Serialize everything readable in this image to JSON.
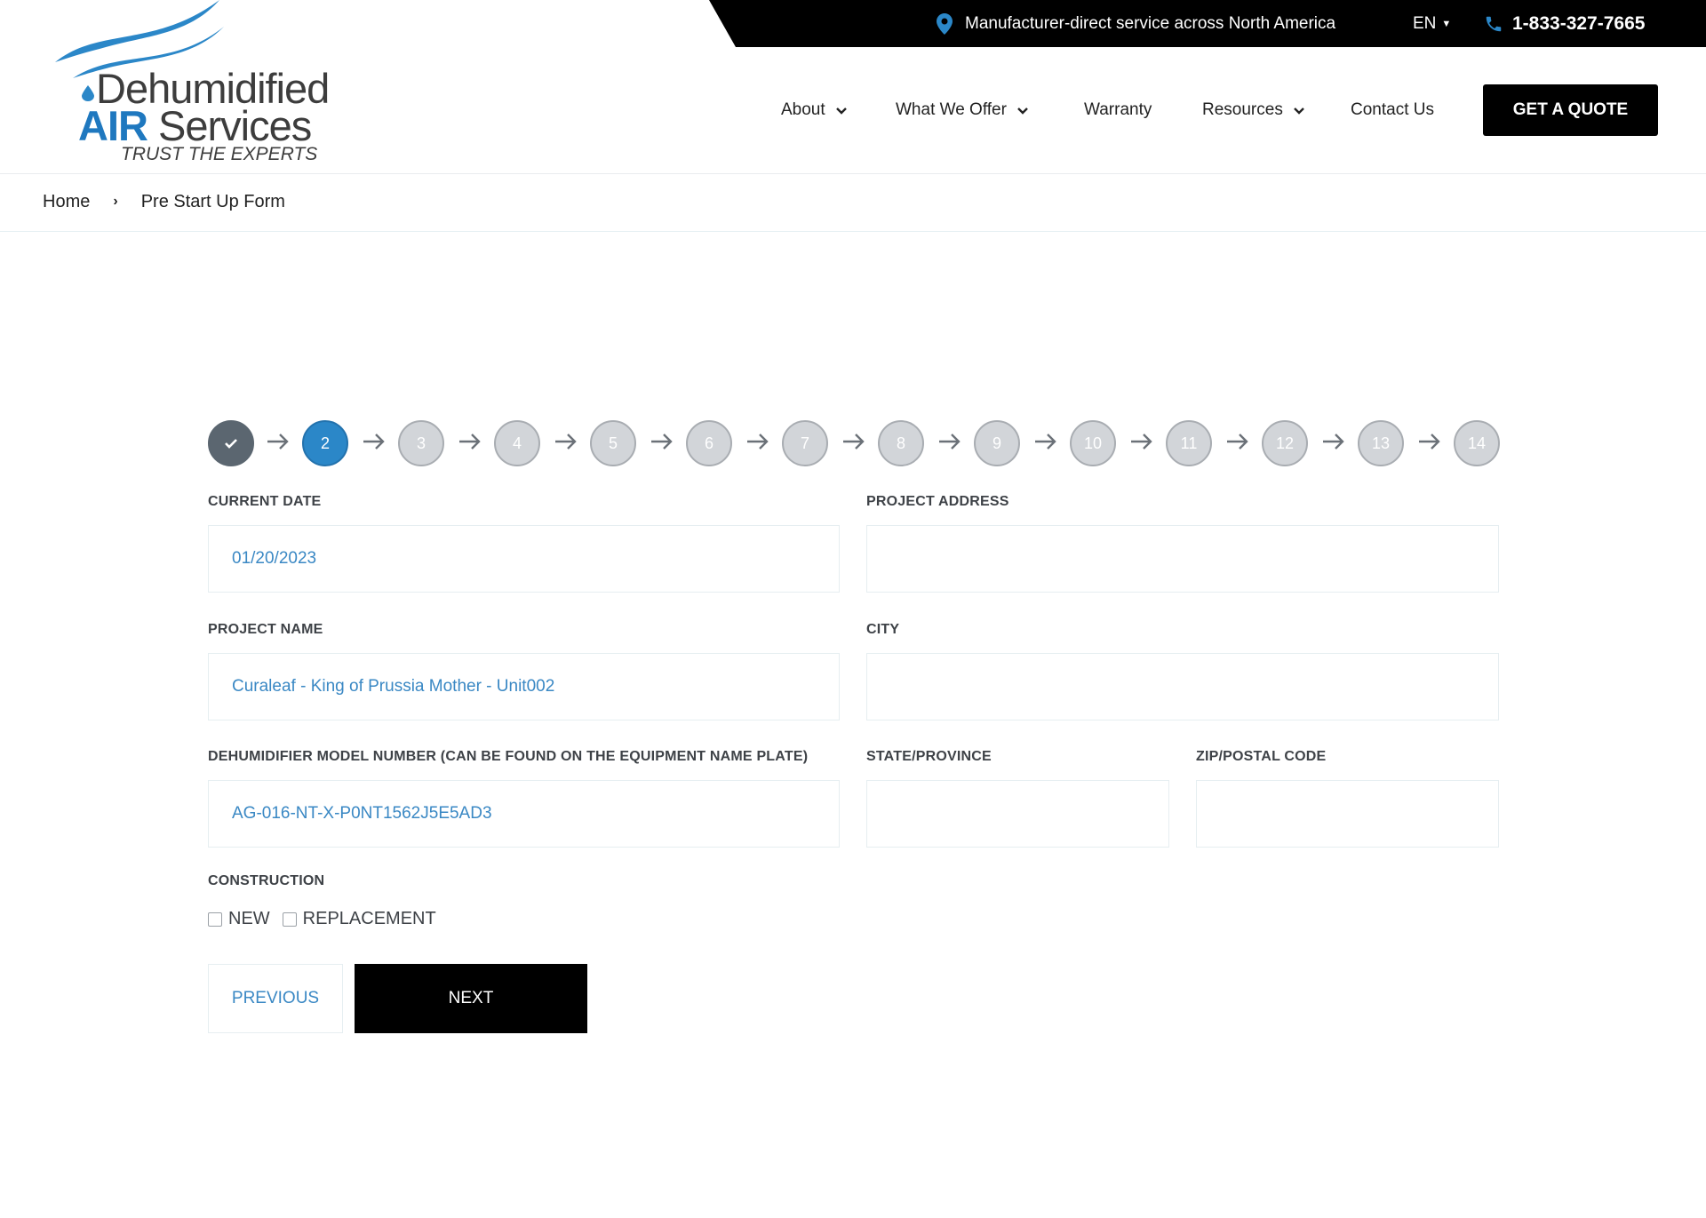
{
  "topbar": {
    "location_text": "Manufacturer-direct service across North America",
    "language": "EN",
    "phone": "1-833-327-7665"
  },
  "logo": {
    "line1": "Dehumidified",
    "line2_bold": "AIR",
    "line2_rest": "Services",
    "tagline": "TRUST THE EXPERTS"
  },
  "nav": {
    "items": [
      {
        "label": "About",
        "has_dropdown": true
      },
      {
        "label": "What We Offer",
        "has_dropdown": true
      },
      {
        "label": "Warranty",
        "has_dropdown": false
      },
      {
        "label": "Resources",
        "has_dropdown": true
      },
      {
        "label": "Contact Us",
        "has_dropdown": false
      }
    ],
    "cta": "GET A QUOTE"
  },
  "breadcrumb": {
    "home": "Home",
    "current": "Pre Start Up Form"
  },
  "steps": {
    "items": [
      "✓",
      "2",
      "3",
      "4",
      "5",
      "6",
      "7",
      "8",
      "9",
      "10",
      "11",
      "12",
      "13",
      "14"
    ],
    "current": 2,
    "completed": 1
  },
  "form": {
    "current_date": {
      "label": "CURRENT DATE",
      "value": "01/20/2023"
    },
    "project_address": {
      "label": "PROJECT ADDRESS",
      "value": ""
    },
    "project_name": {
      "label": "PROJECT NAME",
      "value": "Curaleaf - King of Prussia Mother - Unit002"
    },
    "city": {
      "label": "CITY",
      "value": ""
    },
    "model_number": {
      "label": "DEHUMIDIFIER MODEL NUMBER (CAN BE FOUND ON THE EQUIPMENT NAME PLATE)",
      "value": "AG-016-NT-X-P0NT1562J5E5AD3"
    },
    "state": {
      "label": "STATE/PROVINCE",
      "value": ""
    },
    "zip": {
      "label": "ZIP/POSTAL CODE",
      "value": ""
    },
    "construction": {
      "label": "CONSTRUCTION",
      "options": [
        {
          "label": "NEW",
          "checked": false
        },
        {
          "label": "REPLACEMENT",
          "checked": false
        }
      ]
    },
    "previous_label": "PREVIOUS",
    "next_label": "NEXT"
  },
  "colors": {
    "accent": "#2b87c8",
    "field_text": "#3a88c4",
    "step_done": "#5b6670",
    "step_pending": "#d2d5d9",
    "black": "#000000"
  }
}
